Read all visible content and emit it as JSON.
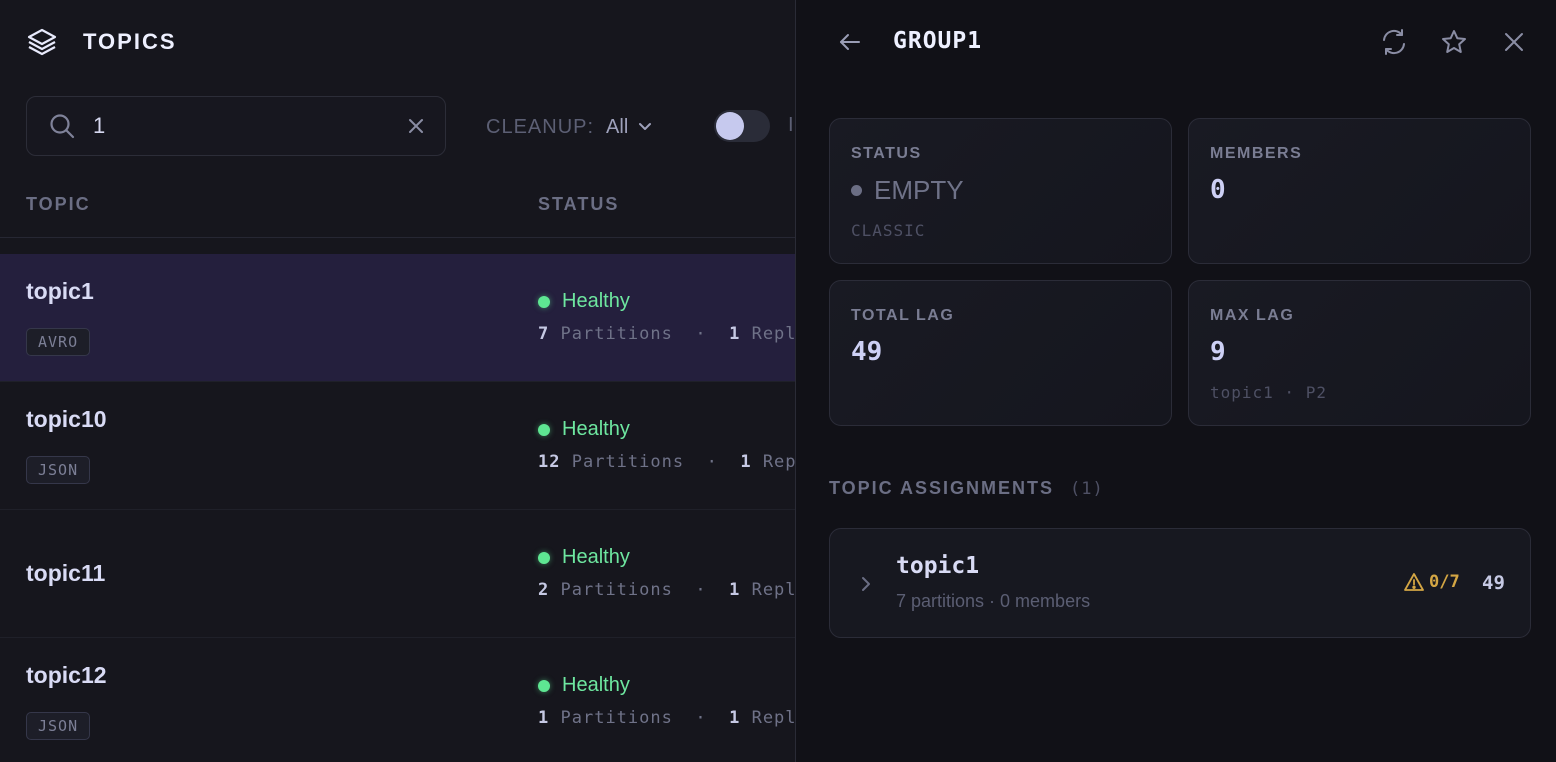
{
  "left": {
    "title": "TOPICS",
    "search": {
      "value": "1"
    },
    "cleanup": {
      "label": "CLEANUP:",
      "value": "All"
    },
    "cut_label": "I",
    "columns": {
      "topic": "TOPIC",
      "status": "STATUS"
    },
    "rows": [
      {
        "name": "topic1",
        "badge": "AVRO",
        "status": "Healthy",
        "partitions": "7",
        "partitions_label": "Partitions",
        "sep": "·",
        "replicas": "1",
        "replicas_label": "Replica"
      },
      {
        "name": "topic10",
        "badge": "JSON",
        "status": "Healthy",
        "partitions": "12",
        "partitions_label": "Partitions",
        "sep": "·",
        "replicas": "1",
        "replicas_label": "Replic"
      },
      {
        "name": "topic11",
        "badge": "",
        "status": "Healthy",
        "partitions": "2",
        "partitions_label": "Partitions",
        "sep": "·",
        "replicas": "1",
        "replicas_label": "Replica"
      },
      {
        "name": "topic12",
        "badge": "JSON",
        "status": "Healthy",
        "partitions": "1",
        "partitions_label": "Partitions",
        "sep": "·",
        "replicas": "1",
        "replicas_label": "Replica"
      }
    ]
  },
  "right": {
    "title": "GROUP1",
    "cards": {
      "status": {
        "label": "STATUS",
        "value": "EMPTY",
        "sub": "CLASSIC"
      },
      "members": {
        "label": "MEMBERS",
        "value": "0"
      },
      "total_lag": {
        "label": "TOTAL LAG",
        "value": "49"
      },
      "max_lag": {
        "label": "MAX LAG",
        "value": "9",
        "sub": "topic1 · P2"
      }
    },
    "assignments": {
      "title": "TOPIC ASSIGNMENTS",
      "count": "(1)",
      "items": [
        {
          "name": "topic1",
          "sub": "7 partitions · 0 members",
          "warn": "0/7",
          "lag": "49"
        }
      ]
    }
  },
  "colors": {
    "healthy": "#5ee692",
    "warning": "#d4a644",
    "selected_row": "#241f3d",
    "accent_text": "#cdd0f5"
  },
  "icons": [
    "layers-icon",
    "search-icon",
    "clear-icon",
    "chevron-down-icon",
    "back-arrow-icon",
    "refresh-icon",
    "star-icon",
    "close-icon",
    "chevron-right-icon",
    "warning-icon"
  ]
}
